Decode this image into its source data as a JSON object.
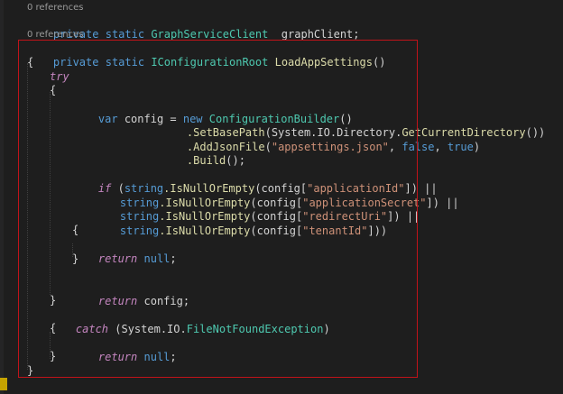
{
  "codelens": {
    "field_refs": "0 references",
    "method_refs": "0 references"
  },
  "code": {
    "field_line": "private static GraphServiceClient _graphClient;",
    "sig": {
      "mod1": "private",
      "mod2": "static",
      "type": "IConfigurationRoot",
      "name": "LoadAppSettings",
      "parens": "()"
    },
    "brace_open": "{",
    "try": "try",
    "try_open": "{",
    "var_kw": "var",
    "var_name": " config = ",
    "new_kw": "new",
    "builder_type": "ConfigurationBuilder",
    "builder_parens": "()",
    "set_base_path": ".SetBasePath",
    "set_base_path_args_open": "(System.IO.Directory.",
    "get_current_dir": "GetCurrentDirectory",
    "set_base_path_args_close": "())",
    "add_json": ".AddJsonFile",
    "add_json_open": "(",
    "appsettings": "\"appsettings.json\"",
    "comma1": ", ",
    "false_kw": "false",
    "comma2": ", ",
    "true_kw": "true",
    "add_json_close": ")",
    "build": ".Build",
    "build_close": "();",
    "if_kw": "if",
    "if_open": " (",
    "string_kw": "string",
    "is_null": ".IsNullOrEmpty",
    "config_open": "(config[",
    "app_id": "\"applicationId\"",
    "close_or": "]) ||",
    "app_secret": "\"applicationSecret\"",
    "redirect": "\"redirectUri\"",
    "tenant": "\"tenantId\"",
    "close_final": "]))",
    "brace2": "{",
    "return_kw": "return",
    "null_kw": "null",
    "semi": ";",
    "brace2_close": "}",
    "return_config": " config;",
    "try_close": "}",
    "catch_kw": "catch",
    "catch_open": " (System.IO.",
    "fnfe": "FileNotFoundException",
    "catch_close": ")",
    "catch_brace": "{",
    "catch_brace_close": "}",
    "brace_close": "}"
  },
  "colors": {
    "highlight_border": "#c0131a",
    "background": "#1e1e1e"
  }
}
